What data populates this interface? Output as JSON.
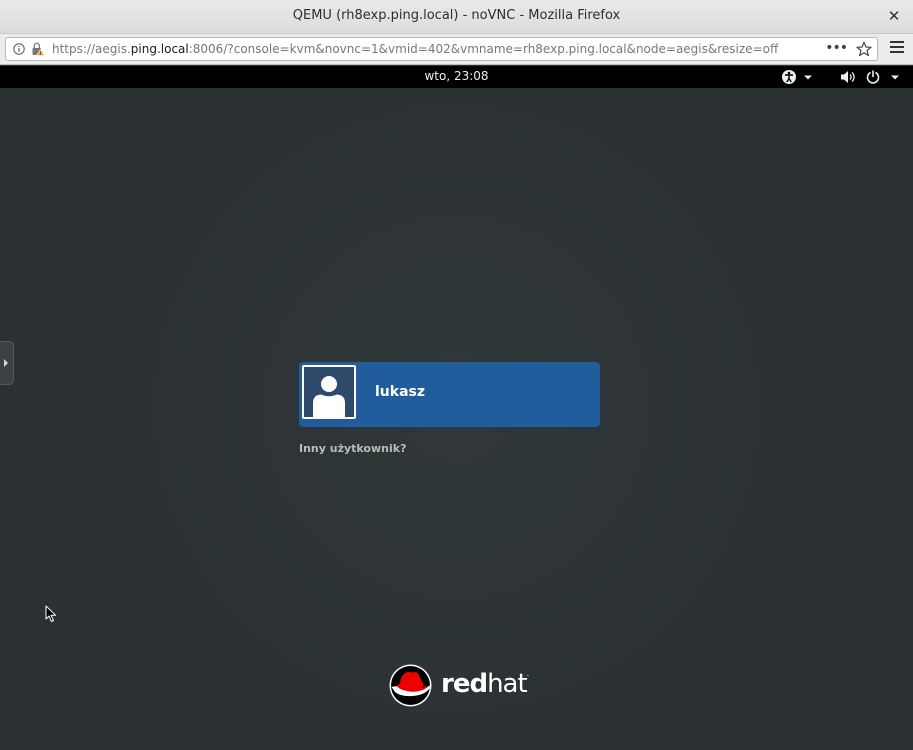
{
  "window": {
    "title": "QEMU (rh8exp.ping.local) - noVNC - Mozilla Firefox",
    "close_glyph": "✕"
  },
  "urlbar": {
    "url_prefix": "https://aegis.",
    "url_host": "ping.local",
    "url_suffix": ":8006/?console=kvm&novnc=1&vmid=402&vmname=rh8exp.ping.local&node=aegis&resize=off",
    "more_glyph": "•••"
  },
  "gdm": {
    "clock": "wto, 23:08",
    "user_name": "lukasz",
    "other_user": "Inny użytkownik?",
    "logo_red": "red",
    "logo_hat": "hat",
    "logo_tm": "."
  },
  "colors": {
    "background": "#2e3436",
    "topbar": "#000000",
    "user_card": "#215d9c",
    "logo_red": "#ee0000"
  },
  "icons": [
    "info-icon",
    "lock-warning-icon",
    "more-actions-icon",
    "bookmark-star-icon",
    "hamburger-menu-icon",
    "accessibility-icon",
    "volume-icon",
    "power-icon",
    "dropdown-arrow-icon",
    "user-avatar-icon",
    "mouse-cursor-icon",
    "redhat-logo-icon"
  ]
}
